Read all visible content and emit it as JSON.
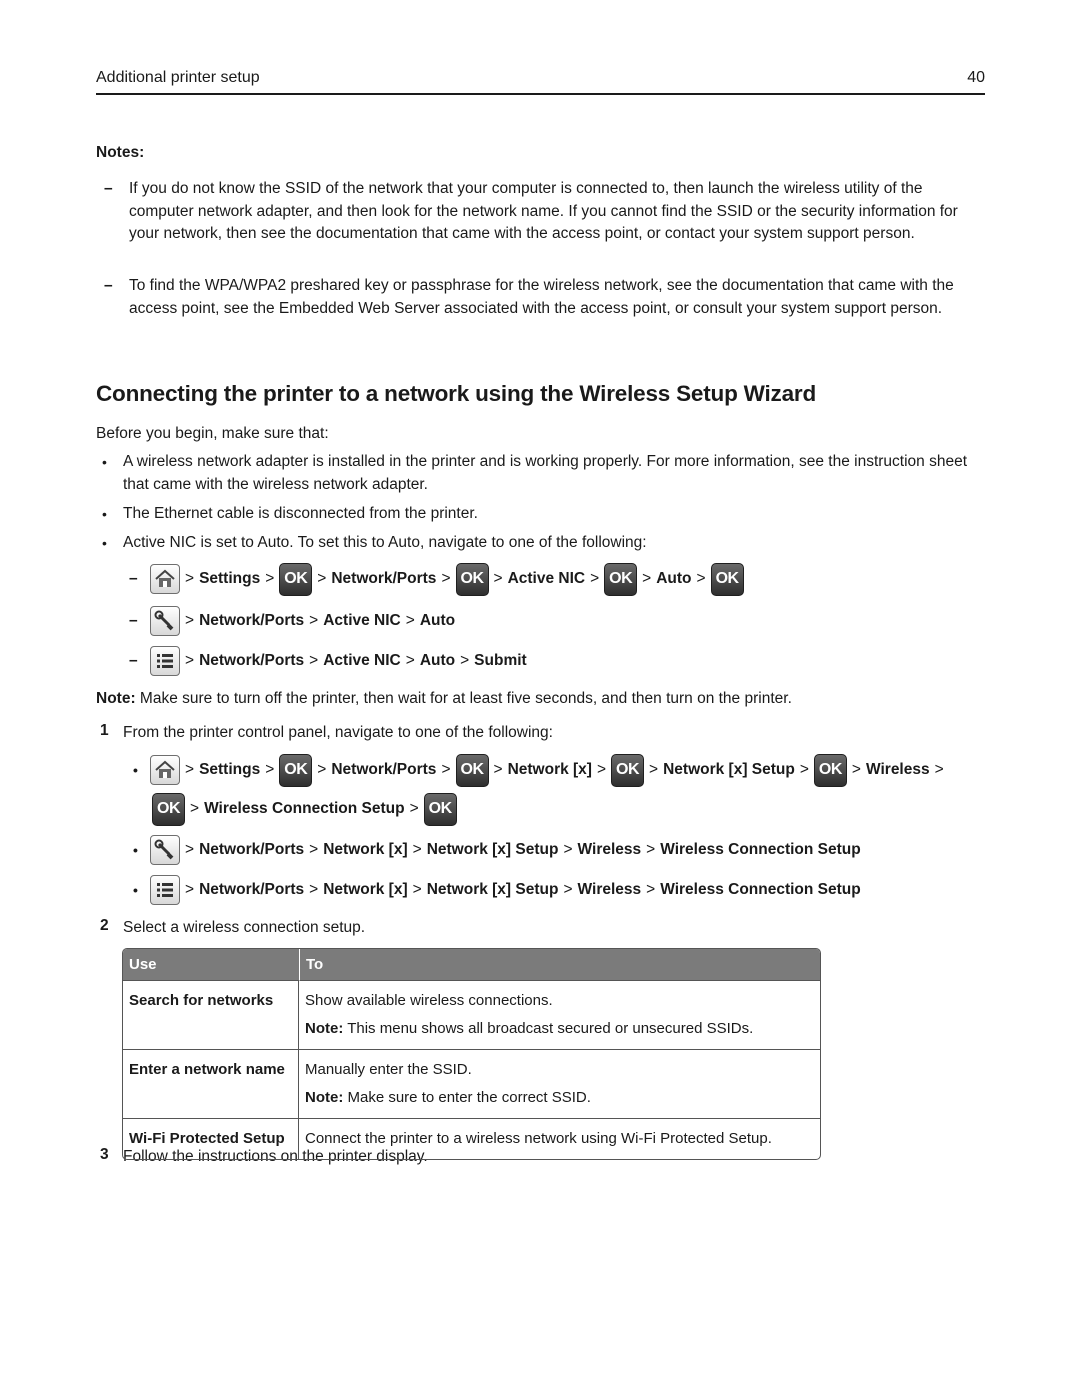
{
  "header": {
    "title": "Additional printer setup",
    "page_number": "40"
  },
  "notes": {
    "label": "Notes:",
    "items": [
      "If you do not know the SSID of the network that your computer is connected to, then launch the wireless utility of the computer network adapter, and then look for the network name. If you cannot find the SSID or the security information for your network, then see the documentation that came with the access point, or contact your system support person.",
      "To find the WPA/WPA2 preshared key or passphrase for the wireless network, see the documentation that came with the access point, see the Embedded Web Server associated with the access point, or consult your system support person."
    ]
  },
  "section": {
    "title": "Connecting the printer to a network using the Wireless Setup Wizard",
    "intro": "Before you begin, make sure that:",
    "prereqs": [
      "A wireless network adapter is installed in the printer and is working properly. For more information, see the instruction sheet that came with the wireless network adapter.",
      "The Ethernet cable is disconnected from the printer.",
      "Active NIC is set to Auto. To set this to Auto, navigate to one of the following:"
    ],
    "nic_paths": {
      "home": [
        "Settings",
        "Network/Ports",
        "Active NIC",
        "Auto"
      ],
      "wrench": [
        "Network/Ports",
        "Active NIC",
        "Auto"
      ],
      "menu": [
        "Network/Ports",
        "Active NIC",
        "Auto",
        "Submit"
      ]
    },
    "note_label": "Note:",
    "note_text": " Make sure to turn off the printer, then wait for at least five seconds, and then turn on the printer.",
    "steps": [
      {
        "num": "1",
        "text": "From the printer control panel, navigate to one of the following:"
      },
      {
        "num": "2",
        "text": "Select a wireless connection setup."
      },
      {
        "num": "3",
        "text": "Follow the instructions on the printer display."
      }
    ],
    "step1_paths": {
      "home": [
        "Settings",
        "Network/Ports",
        "Network [x]",
        "Network [x] Setup",
        "Wireless",
        "Wireless Connection Setup"
      ],
      "wrench": [
        "Network/Ports",
        "Network [x]",
        "Network [x] Setup",
        "Wireless",
        "Wireless Connection Setup"
      ],
      "menu": [
        "Network/Ports",
        "Network [x]",
        "Network [x] Setup",
        "Wireless",
        "Wireless Connection Setup"
      ]
    },
    "separator": ">",
    "ok_label": "OK",
    "dash": "–",
    "bullet": "•"
  },
  "table": {
    "headers": [
      "Use",
      "To"
    ],
    "rows": [
      {
        "use": "Search for networks",
        "to": "Show available wireless connections.",
        "note_label": "Note:",
        "note": " This menu shows all broadcast secured or unsecured SSIDs."
      },
      {
        "use": "Enter a network name",
        "to": "Manually enter the SSID.",
        "note_label": "Note:",
        "note": " Make sure to enter the correct SSID."
      },
      {
        "use": "Wi‑Fi Protected Setup",
        "to": "Connect the printer to a wireless network using Wi‑Fi Protected Setup."
      }
    ]
  },
  "icons": {
    "home": "home-icon",
    "wrench": "wrench-icon",
    "menu": "menu-list-icon",
    "ok": "ok-button-icon"
  }
}
